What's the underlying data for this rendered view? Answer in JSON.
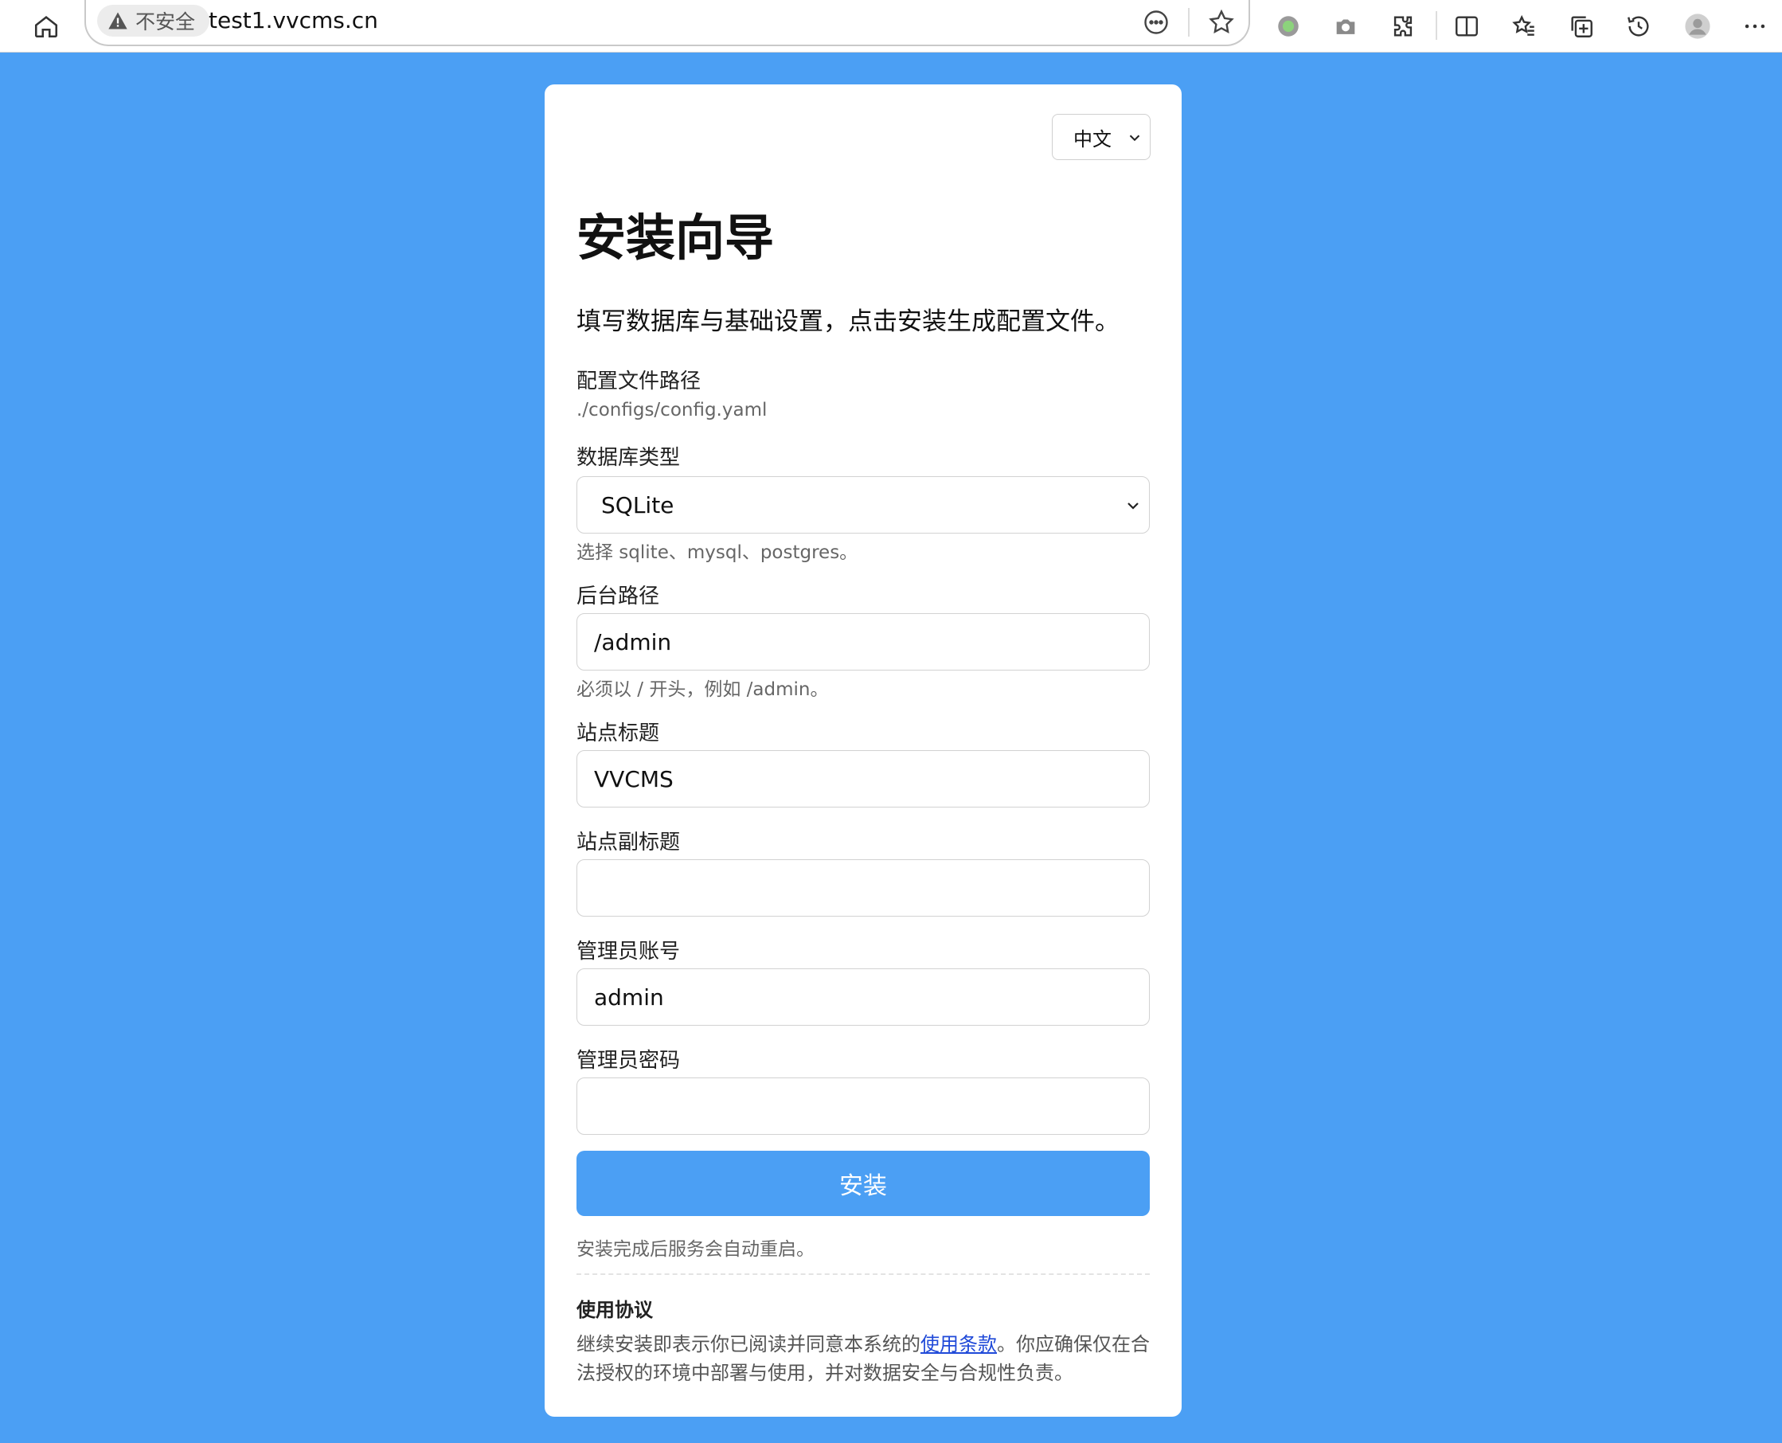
{
  "browser": {
    "security_label": "不安全",
    "url": "test1.vvcms.cn"
  },
  "card": {
    "language": "中文",
    "title": "安装向导",
    "subtitle": "填写数据库与基础设置，点击安装生成配置文件。",
    "config_path_label": "配置文件路径",
    "config_path_value": "./configs/config.yaml",
    "db_type_label": "数据库类型",
    "db_type_value": "SQLite",
    "db_type_hint": "选择 sqlite、mysql、postgres。",
    "admin_path_label": "后台路径",
    "admin_path_value": "/admin",
    "admin_path_hint": "必须以 / 开头，例如 /admin。",
    "site_title_label": "站点标题",
    "site_title_value": "VVCMS",
    "site_subtitle_label": "站点副标题",
    "site_subtitle_value": "",
    "admin_account_label": "管理员账号",
    "admin_account_value": "admin",
    "admin_password_label": "管理员密码",
    "admin_password_value": "",
    "install_button": "安装",
    "install_note": "安装完成后服务会自动重启。",
    "terms_heading": "使用协议",
    "terms_text_before": "继续安装即表示你已阅读并同意本系统的",
    "terms_link": "使用条款",
    "terms_text_after": "。你应确保仅在合法授权的环境中部署与使用，并对数据安全与合规性负责。"
  },
  "colors": {
    "page_background": "#4b9ff4",
    "button": "#4b9ff4",
    "link": "#1f49d8"
  }
}
